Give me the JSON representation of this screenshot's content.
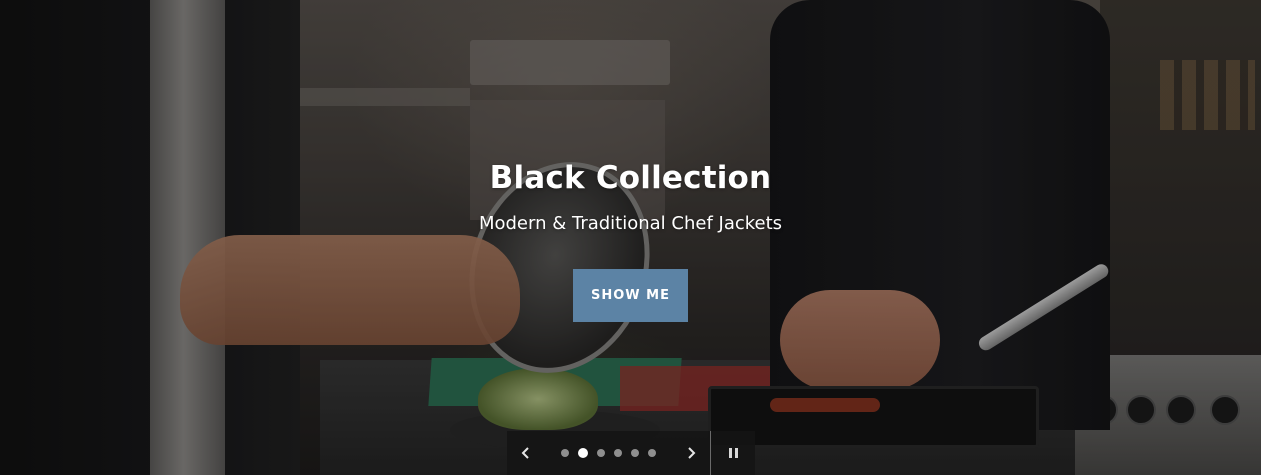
{
  "slide": {
    "title": "Black Collection",
    "subtitle": "Modern & Traditional Chef Jackets",
    "cta_label": "SHOW ME"
  },
  "slider": {
    "slide_count": 6,
    "active_index": 1,
    "prev_icon": "chevron-left-icon",
    "next_icon": "chevron-right-icon",
    "pause_icon": "pause-icon"
  },
  "colors": {
    "cta_background": "#5c83a5",
    "controls_background": "#141414",
    "dot_active": "#ffffff",
    "dot_inactive": "#8f8f8f"
  }
}
